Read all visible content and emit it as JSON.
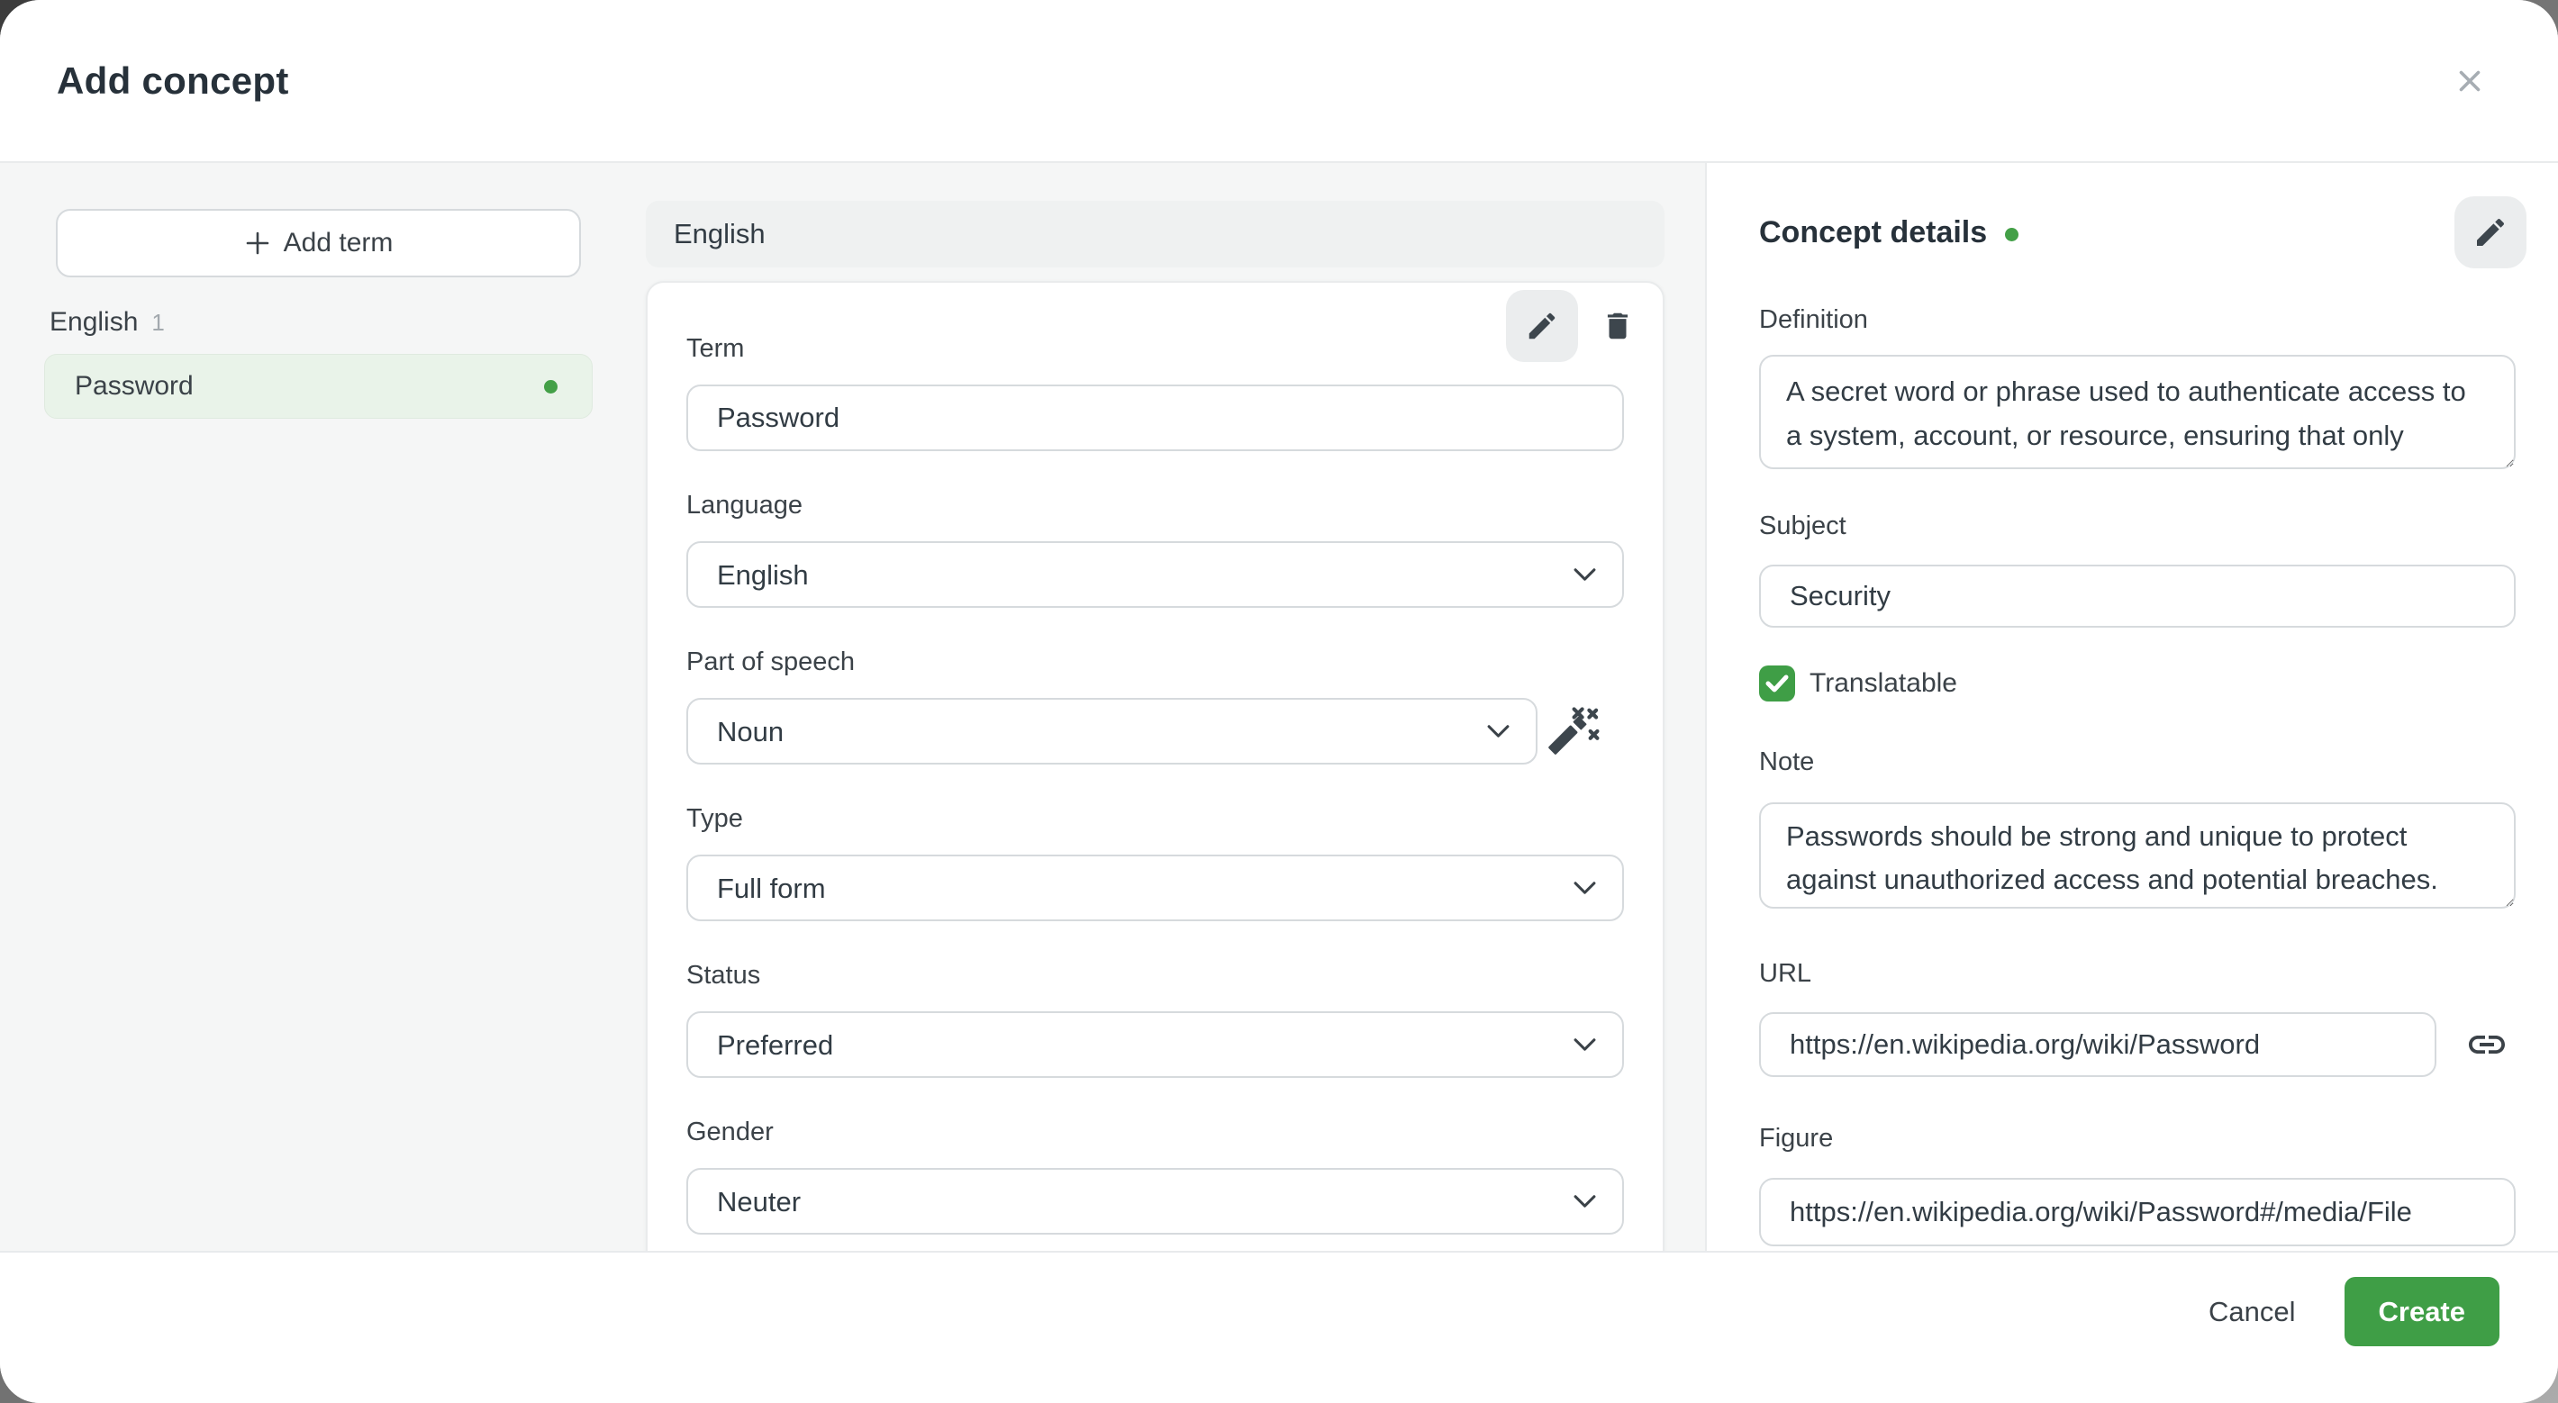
{
  "header": {
    "title": "Add concept"
  },
  "sidebar": {
    "add_term_label": "Add term",
    "group": {
      "name": "English",
      "count": "1"
    },
    "terms": [
      {
        "label": "Password"
      }
    ]
  },
  "term_editor": {
    "language_header": "English",
    "term": {
      "label": "Term",
      "value": "Password"
    },
    "language": {
      "label": "Language",
      "value": "English"
    },
    "part_of_speech": {
      "label": "Part of speech",
      "value": "Noun"
    },
    "type": {
      "label": "Type",
      "value": "Full form"
    },
    "status": {
      "label": "Status",
      "value": "Preferred"
    },
    "gender": {
      "label": "Gender",
      "value": "Neuter"
    }
  },
  "details": {
    "title": "Concept details",
    "definition": {
      "label": "Definition",
      "value": "A secret word or phrase used to authenticate access to a system, account, or resource, ensuring that only authorized users can gain entry."
    },
    "subject": {
      "label": "Subject",
      "value": "Security"
    },
    "translatable": {
      "label": "Translatable",
      "checked": true
    },
    "note": {
      "label": "Note",
      "value": "Passwords should be strong and unique to protect against unauthorized access and potential breaches."
    },
    "url": {
      "label": "URL",
      "value": "https://en.wikipedia.org/wiki/Password"
    },
    "figure": {
      "label": "Figure",
      "value": "https://en.wikipedia.org/wiki/Password#/media/File"
    }
  },
  "footer": {
    "cancel_label": "Cancel",
    "create_label": "Create"
  },
  "colors": {
    "accent_green": "#43a047",
    "button_green": "#3f9e46",
    "selected_term_bg": "#e9f3e9"
  }
}
